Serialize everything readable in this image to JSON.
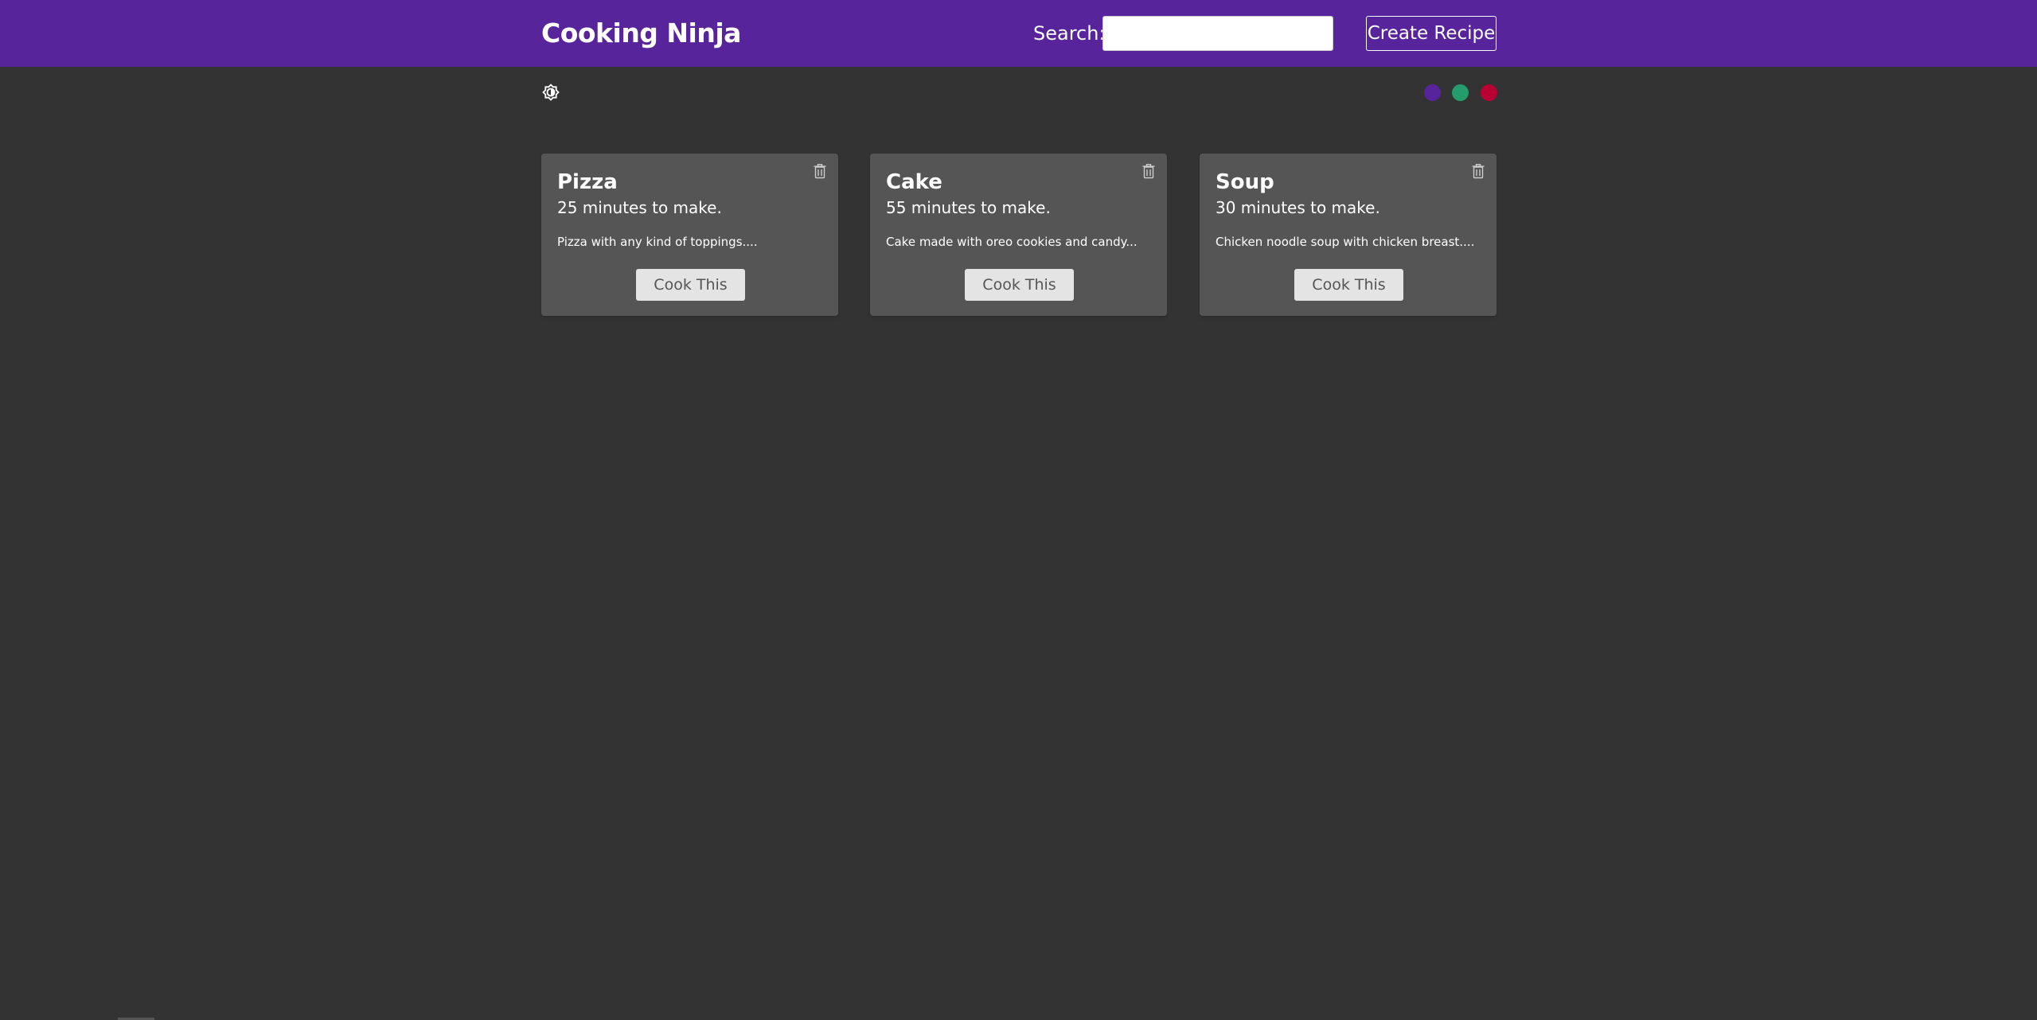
{
  "navbar": {
    "brand": "Cooking Ninja",
    "search_label": "Search:",
    "search_value": "",
    "search_placeholder": "",
    "create_label": "Create Recipe",
    "background": "#58249c"
  },
  "toolbar": {
    "mode_icon": "brightness-toggle-icon",
    "theme_colors": [
      "#58249c",
      "#249c6b",
      "#b70233"
    ]
  },
  "recipes": [
    {
      "title": "Pizza",
      "time": "25 minutes to make.",
      "description": "Pizza with any kind of toppings....",
      "button": "Cook This",
      "delete_icon": "trash-icon"
    },
    {
      "title": "Cake",
      "time": "55 minutes to make.",
      "description": "Cake made with oreo cookies and candy...",
      "button": "Cook This",
      "delete_icon": "trash-icon"
    },
    {
      "title": "Soup",
      "time": "30 minutes to make.",
      "description": "Chicken noodle soup with chicken breast....",
      "button": "Cook This",
      "delete_icon": "trash-icon"
    }
  ]
}
